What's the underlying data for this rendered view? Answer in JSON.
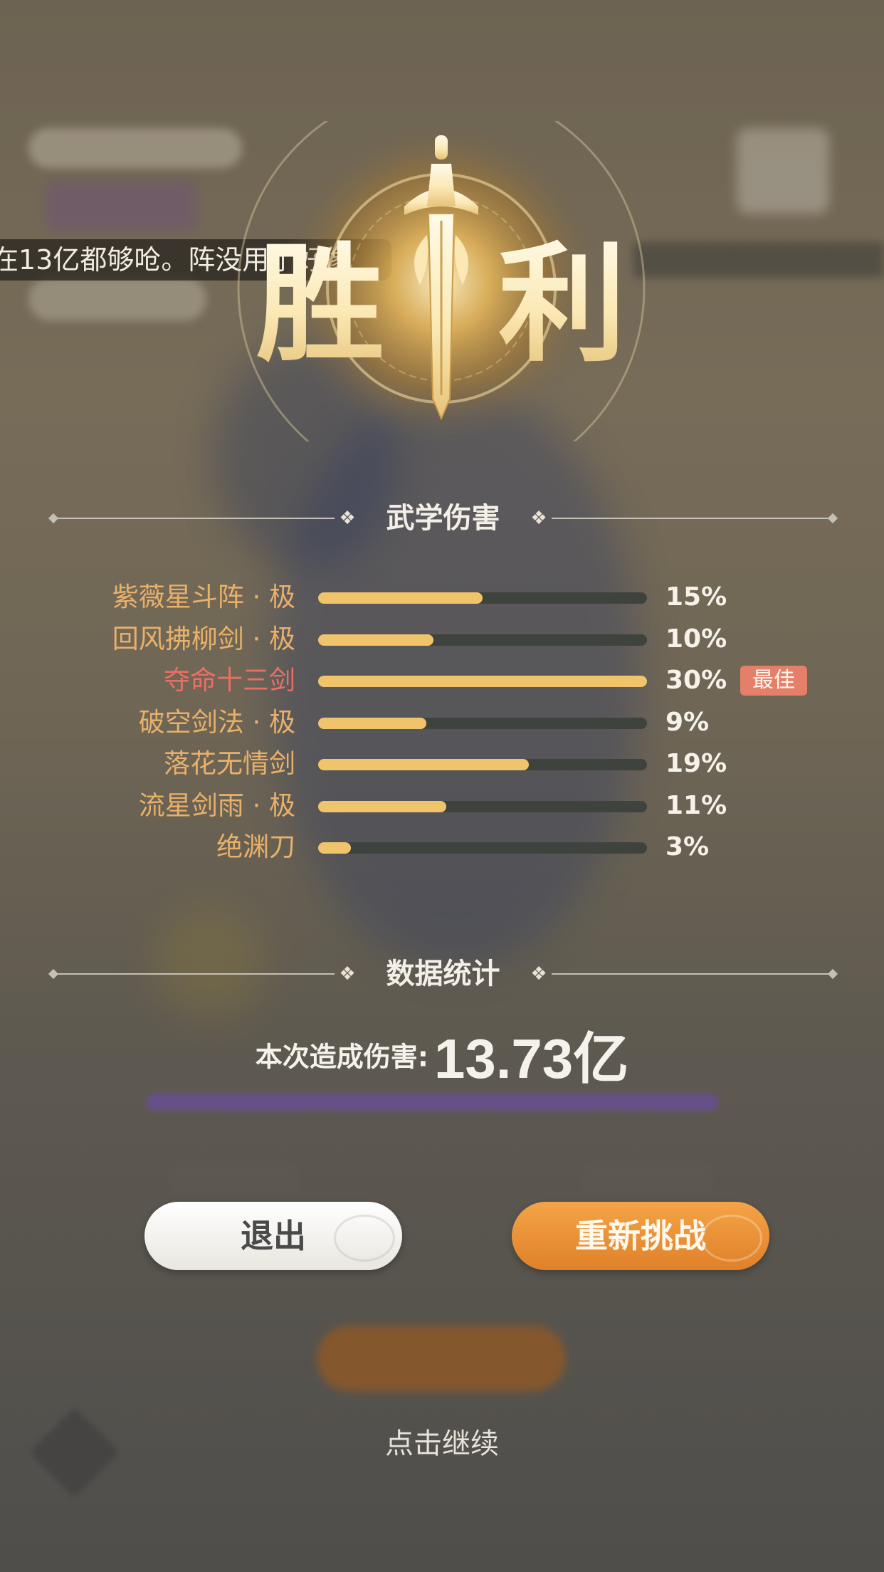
{
  "banner": {
    "text": "在13亿都够呛。阵没用了好像"
  },
  "victory": {
    "title_left": "胜",
    "title_right": "利"
  },
  "martial_damage": {
    "title": "武学伤害",
    "rows": [
      {
        "name": "紫薇星斗阵 · 极",
        "percent_label": "15%",
        "fraction": 0.5,
        "best": false
      },
      {
        "name": "回风拂柳剑 · 极",
        "percent_label": "10%",
        "fraction": 0.35,
        "best": false
      },
      {
        "name": "夺命十三剑",
        "percent_label": "30%",
        "fraction": 1.0,
        "best": true
      },
      {
        "name": "破空剑法 · 极",
        "percent_label": "9%",
        "fraction": 0.33,
        "best": false
      },
      {
        "name": "落花无情剑",
        "percent_label": "19%",
        "fraction": 0.64,
        "best": false
      },
      {
        "name": "流星剑雨 · 极",
        "percent_label": "11%",
        "fraction": 0.39,
        "best": false
      },
      {
        "name": "绝渊刀",
        "percent_label": "3%",
        "fraction": 0.1,
        "best": false
      }
    ],
    "best_badge": "最佳"
  },
  "statistics": {
    "title": "数据统计",
    "damage_label": "本次造成伤害:",
    "damage_value": "13.73亿"
  },
  "buttons": {
    "exit": "退出",
    "retry": "重新挑战"
  },
  "continue_hint": "点击继续",
  "colors": {
    "bar_fill": "#f0c46a",
    "name_color": "#e9b06a",
    "best_color": "#e96f64",
    "retry_button": "#e8902f"
  }
}
